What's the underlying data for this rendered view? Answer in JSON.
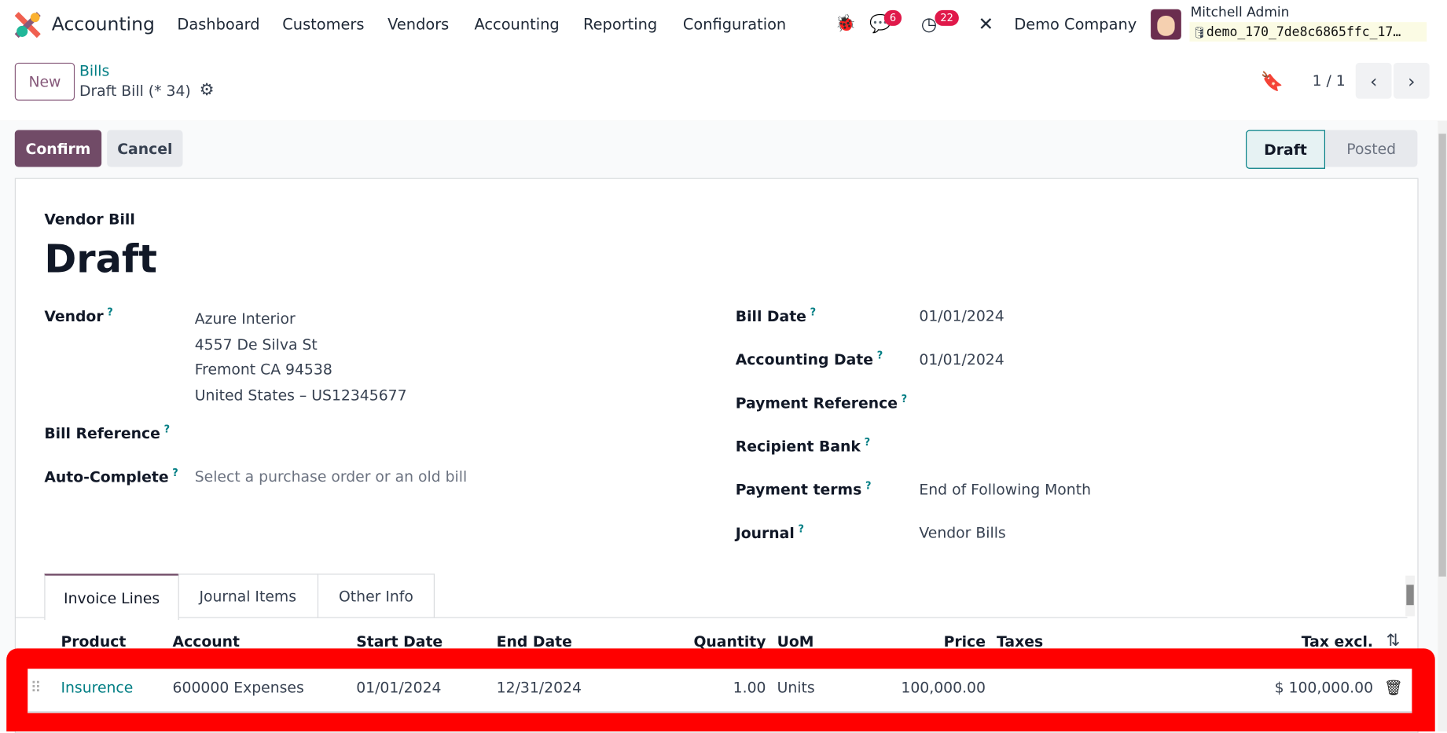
{
  "app": {
    "name": "Accounting",
    "menu": [
      "Dashboard",
      "Customers",
      "Vendors",
      "Accounting",
      "Reporting",
      "Configuration"
    ],
    "messages_count": "6",
    "activities_count": "22",
    "company": "Demo Company",
    "user": "Mitchell Admin",
    "database": "demo_170_7de8c6865ffc_17…"
  },
  "control": {
    "new_label": "New",
    "breadcrumb_parent": "Bills",
    "record_name": "Draft Bill (* 34)",
    "pager": "1 / 1",
    "confirm": "Confirm",
    "cancel": "Cancel",
    "stages": [
      "Draft",
      "Posted"
    ]
  },
  "form": {
    "type": "Vendor Bill",
    "title": "Draft",
    "left": {
      "vendor_label": "Vendor",
      "vendor_lines": [
        "Azure Interior",
        "4557 De Silva St",
        "Fremont CA 94538",
        "United States – US12345677"
      ],
      "bill_ref_label": "Bill Reference",
      "autocomplete_label": "Auto-Complete",
      "autocomplete_placeholder": "Select a purchase order or an old bill"
    },
    "right": [
      {
        "label": "Bill Date",
        "value": "01/01/2024"
      },
      {
        "label": "Accounting Date",
        "value": "01/01/2024"
      },
      {
        "label": "Payment Reference",
        "value": ""
      },
      {
        "label": "Recipient Bank",
        "value": ""
      },
      {
        "label": "Payment terms",
        "value": "End of Following Month"
      },
      {
        "label": "Journal",
        "value": "Vendor Bills"
      }
    ],
    "help": "?"
  },
  "tabs": [
    "Invoice Lines",
    "Journal Items",
    "Other Info"
  ],
  "table": {
    "headers": [
      "Product",
      "Account",
      "Start Date",
      "End Date",
      "Quantity",
      "UoM",
      "Price",
      "Taxes",
      "Tax excl."
    ],
    "rows": [
      {
        "product": "Insurence",
        "account": "600000 Expenses",
        "start": "01/01/2024",
        "end": "12/31/2024",
        "quantity": "1.00",
        "uom": "Units",
        "price": "100,000.00",
        "taxes": "",
        "subtotal": "$ 100,000.00"
      }
    ]
  }
}
